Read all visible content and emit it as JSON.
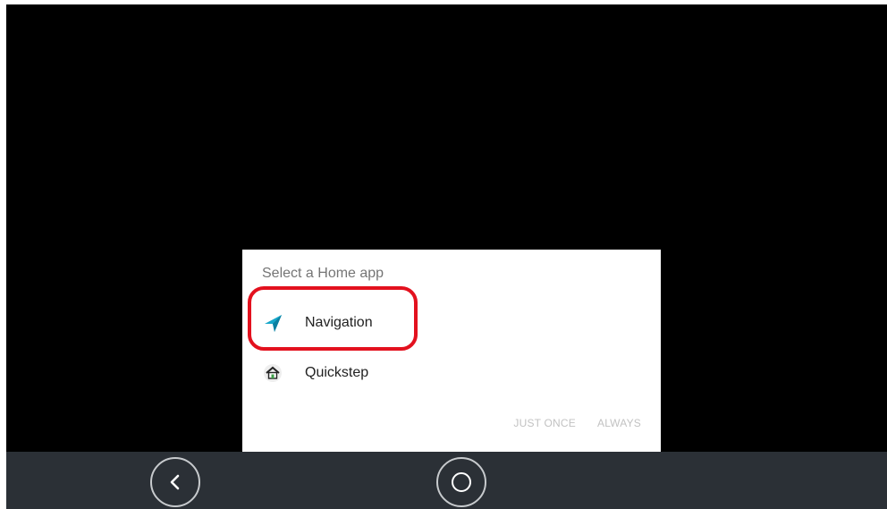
{
  "dialog": {
    "title": "Select a Home app",
    "apps": [
      {
        "label": "Navigation",
        "icon": "navigation-arrow-icon"
      },
      {
        "label": "Quickstep",
        "icon": "home-icon"
      }
    ],
    "actions": {
      "just_once": "JUST ONCE",
      "always": "ALWAYS"
    },
    "highlight_color": "#e3111e"
  },
  "navbar": {
    "buttons": [
      {
        "icon": "back-chevron-icon"
      },
      {
        "icon": "home-circle-icon"
      }
    ]
  }
}
